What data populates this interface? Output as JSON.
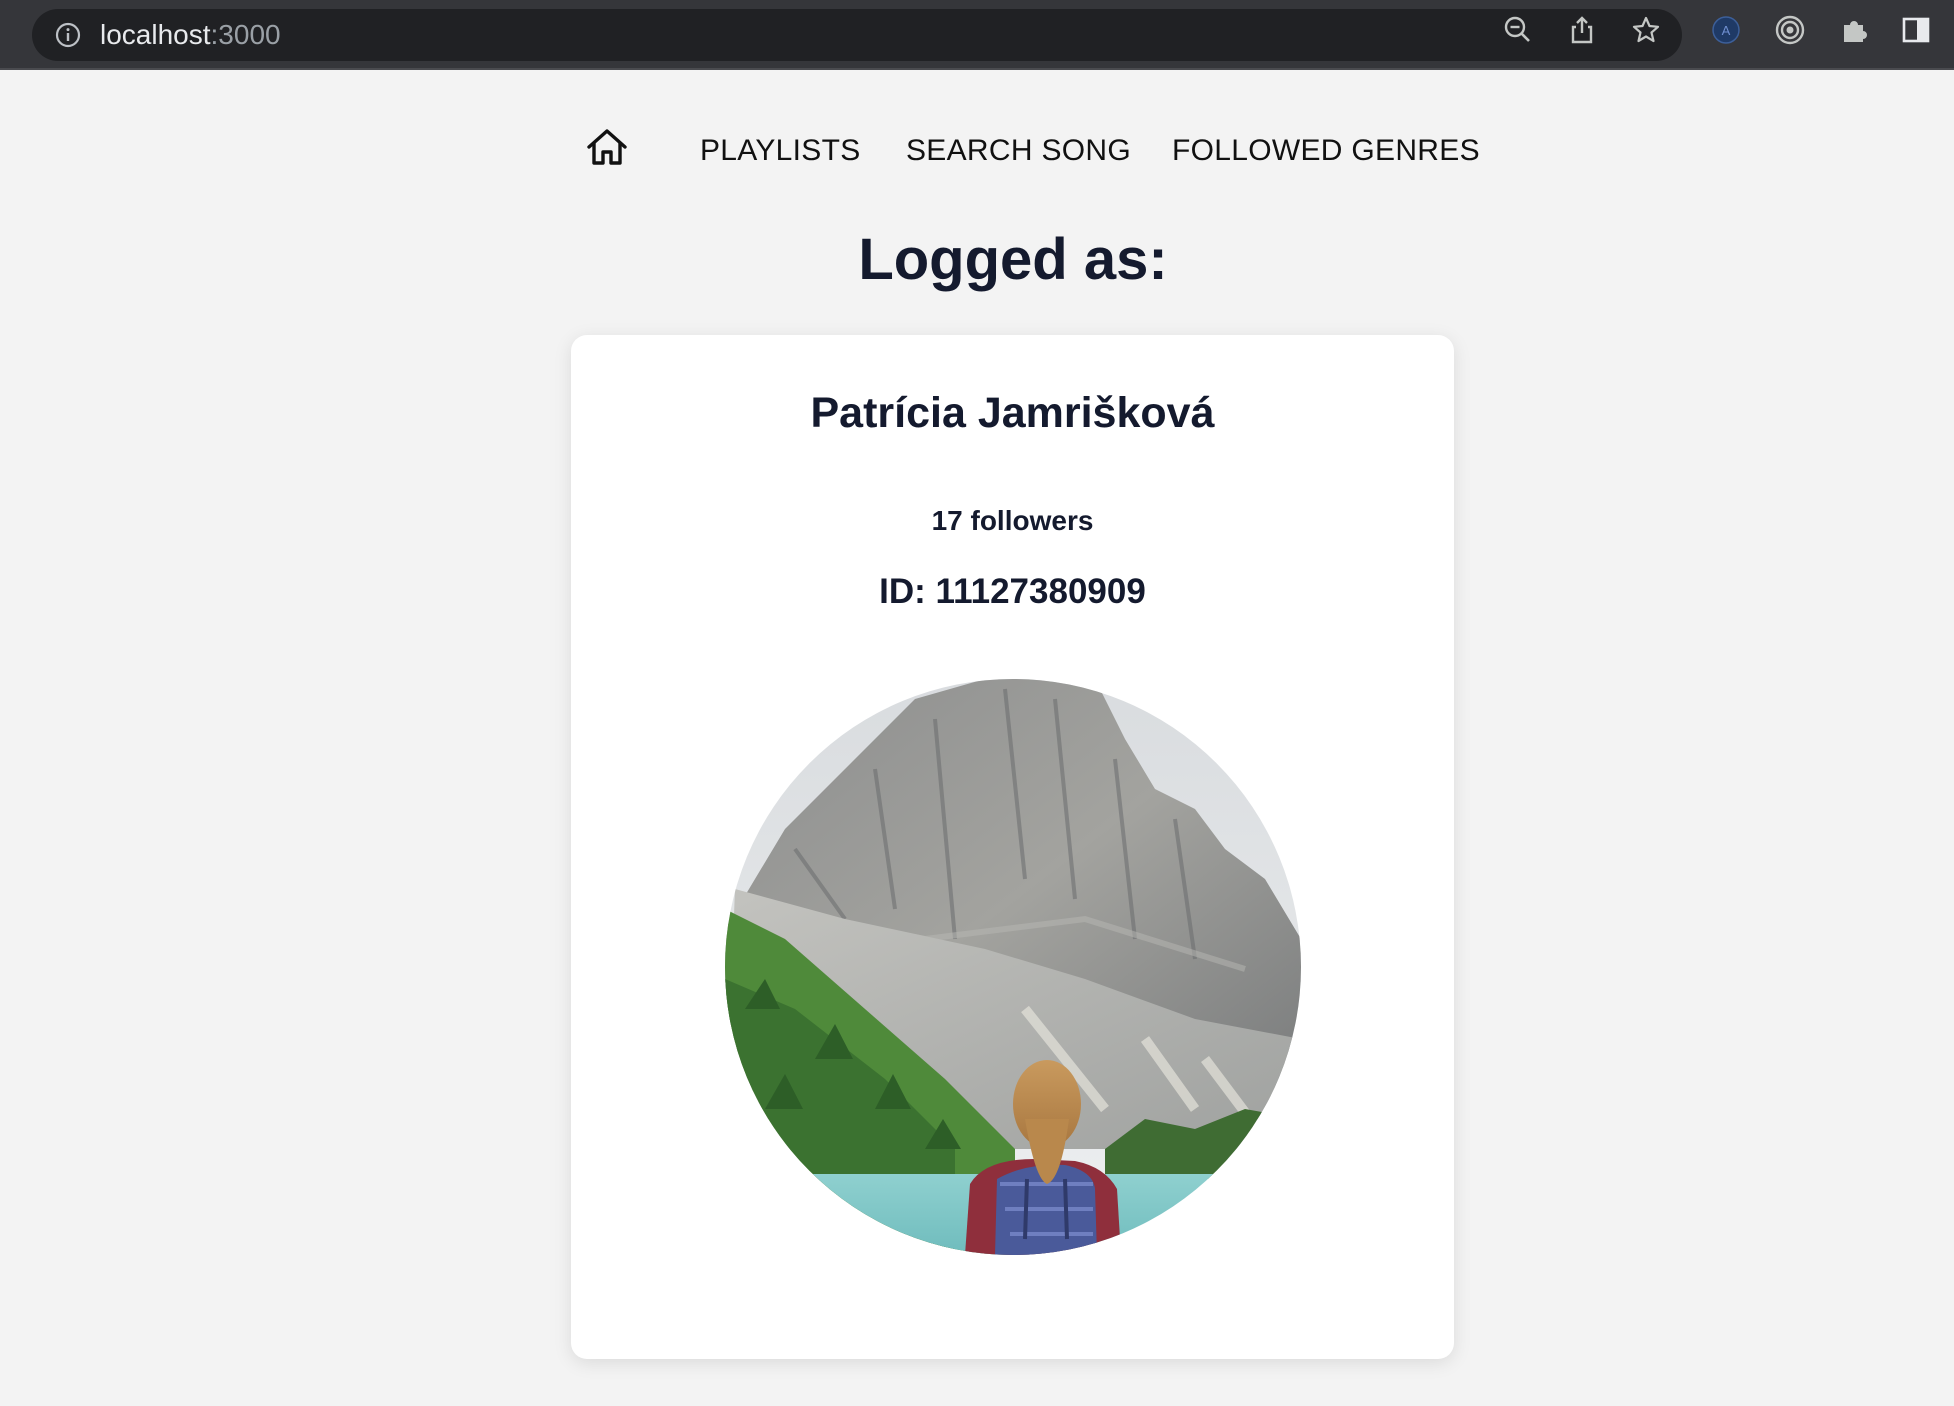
{
  "browser": {
    "url_host": "localhost",
    "url_port": ":3000",
    "icons": [
      "info-icon",
      "zoom-out-icon",
      "share-icon",
      "bookmark-star-icon",
      "account-icon",
      "target-extension-icon",
      "extensions-puzzle-icon",
      "side-panel-icon"
    ]
  },
  "nav": {
    "home_icon": "home-icon",
    "links": [
      "PLAYLISTS",
      "SEARCH SONG",
      "FOLLOWED GENRES"
    ]
  },
  "main": {
    "title": "Logged as:"
  },
  "profile": {
    "name": "Patrícia Jamrišková",
    "followers": "17 followers",
    "id": "ID: 11127380909",
    "avatar": "profile-photo-mountain-lake"
  },
  "colors": {
    "text_dark": "#141a2e",
    "background": "#f3f3f3",
    "card": "#ffffff",
    "chrome": "#35363a"
  }
}
